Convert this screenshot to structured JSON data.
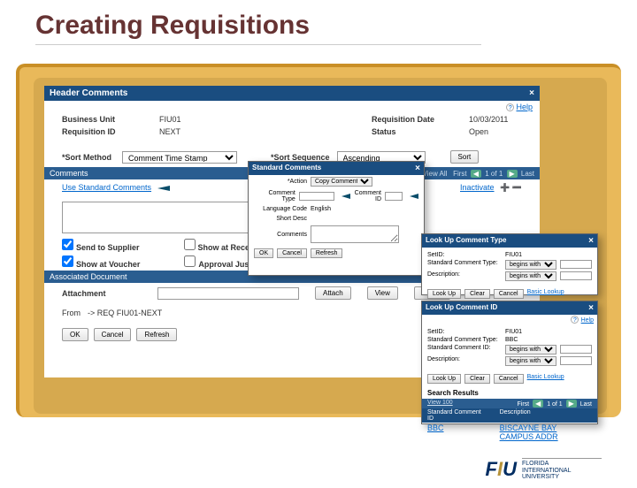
{
  "slide": {
    "title": "Creating Requisitions"
  },
  "header": {
    "title": "Header Comments",
    "help": "Help"
  },
  "form": {
    "bu_label": "Business Unit",
    "bu_val": "FIU01",
    "reqdate_label": "Requisition Date",
    "reqdate_val": "10/03/2011",
    "reqid_label": "Requisition ID",
    "reqid_val": "NEXT",
    "status_label": "Status",
    "status_val": "Open",
    "sort_method_label": "*Sort Method",
    "sort_method_val": "Comment Time Stamp",
    "sort_seq_label": "*Sort Sequence",
    "sort_seq_val": "Ascending",
    "sort_btn": "Sort"
  },
  "comments": {
    "bar": "Comments",
    "pager": "Find | View All   First   1 of 1   Last",
    "use_std": "Use Standard Comments",
    "inactivate": "Inactivate",
    "send_supplier": "Send to Supplier",
    "show_recei": "Show at Receipt",
    "show_voucher": "Show at Voucher",
    "approval_just": "Approval Justification"
  },
  "assoc": {
    "bar": "Associated Document",
    "attach_lbl": "Attachment",
    "attach_btn": "Attach",
    "view_btn": "View",
    "delete_btn": "Delete",
    "from_lbl": "From",
    "from_val": "-> REQ FIU01-NEXT"
  },
  "btm": {
    "ok": "OK",
    "cancel": "Cancel",
    "refresh": "Refresh"
  },
  "popc": {
    "title": "Standard Comments",
    "action_lbl": "*Action",
    "action_val": "Copy Comment",
    "ctype_lbl": "Comment Type",
    "cid_lbl": "Comment ID",
    "lang_lbl": "Language Code",
    "lang_val": "English",
    "shortd_lbl": "Short Desc",
    "comm_lbl": "Comments",
    "ok": "OK",
    "cancel": "Cancel",
    "refresh": "Refresh"
  },
  "popt": {
    "title": "Look Up Comment Type",
    "setid_lbl": "SetID:",
    "setid_val": "FIU01",
    "sct_lbl": "Standard Comment Type:",
    "desc_lbl": "Description:",
    "begins": "begins with",
    "lookup": "Look Up",
    "clear": "Clear",
    "cancel": "Cancel",
    "basic": "Basic Lookup"
  },
  "popid": {
    "title": "Look Up Comment ID",
    "setid_lbl": "SetID:",
    "setid_val": "FIU01",
    "sct_lbl": "Standard Comment Type:",
    "sct_val": "BBC",
    "sci_lbl": "Standard Comment ID:",
    "desc_lbl": "Description:",
    "begins": "begins with",
    "lookup": "Look Up",
    "clear": "Clear",
    "cancel": "Cancel",
    "basic": "Basic Lookup",
    "sr": "Search Results",
    "view100": "View 100",
    "first": "First",
    "one": "1 of 1",
    "last": "Last",
    "col1": "Standard Comment ID",
    "col2": "Description",
    "row1c1": "BBC",
    "row1c2": "BISCAYNE BAY CAMPUS ADDR"
  },
  "fiu": {
    "name": "FLORIDA INTERNATIONAL UNIVERSITY"
  }
}
